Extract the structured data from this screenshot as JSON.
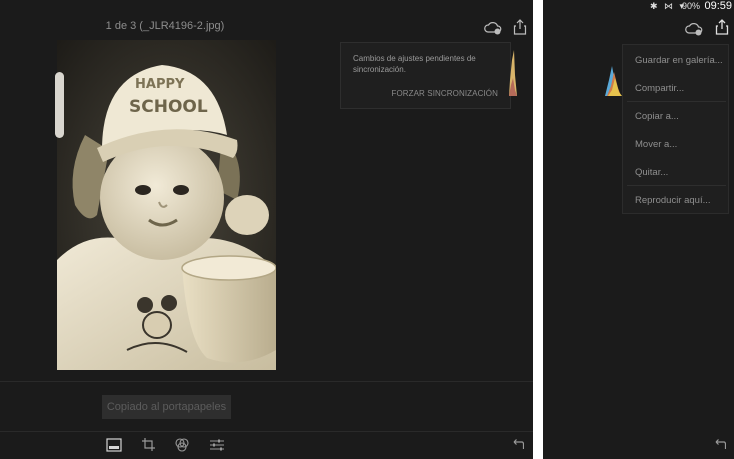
{
  "left": {
    "title": "1 de 3 (_JLR4196-2.jpg)",
    "sync_message": "Cambios de ajustes pendientes de sincronización.",
    "force_sync_label": "FORZAR SINCRONIZACIÓN",
    "toast": "Copiado al portapapeles",
    "photo_text": {
      "cap_line1": "HAPPY",
      "cap_line2": "SCHOOL"
    },
    "toolbar": [
      "layout-icon",
      "crop-icon",
      "color-wheel-icon",
      "adjust-sliders-icon"
    ],
    "undo_icon": "undo-icon"
  },
  "right": {
    "status": {
      "icons": "✱ ⋈ ▾",
      "battery": "90%",
      "time": "09:59"
    },
    "menu": {
      "items": [
        "Guardar en galería...",
        "Compartir...",
        "Copiar a...",
        "Mover a...",
        "Quitar...",
        "Reproducir aquí..."
      ]
    }
  },
  "colors": {
    "background": "#1b1b1b",
    "panel": "#1f1f1f",
    "text_dim": "#8d8d8d",
    "sepia_light": "#e6ddc6",
    "sepia_dark": "#2c2a25"
  }
}
